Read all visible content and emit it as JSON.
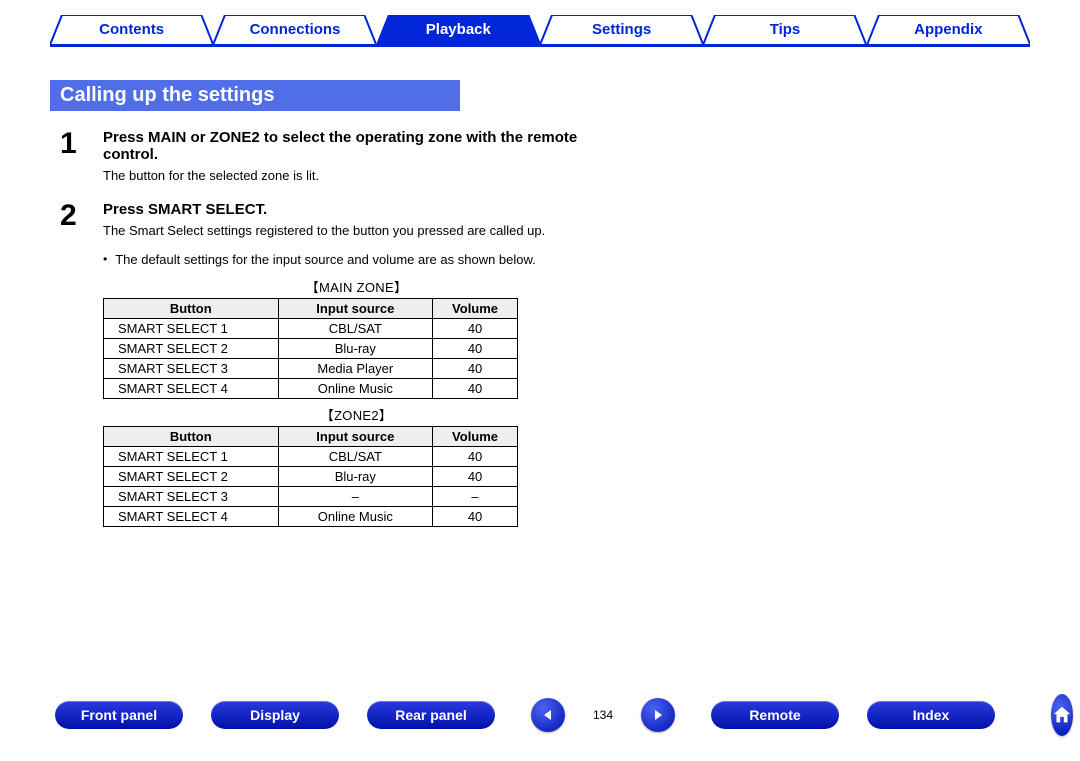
{
  "nav": {
    "tabs": [
      "Contents",
      "Connections",
      "Playback",
      "Settings",
      "Tips",
      "Appendix"
    ],
    "active_index": 2
  },
  "heading": "Calling up the settings",
  "steps": [
    {
      "num": "1",
      "title": "Press MAIN or ZONE2 to select the operating zone with the remote control.",
      "note": "The button for the selected zone is lit."
    },
    {
      "num": "2",
      "title": "Press SMART SELECT.",
      "note": "The Smart Select settings registered to the button you pressed are called up."
    }
  ],
  "bullet": "The default settings for the input source and volume are as shown below.",
  "tables": [
    {
      "caption": "【MAIN ZONE】",
      "headers": [
        "Button",
        "Input source",
        "Volume"
      ],
      "rows": [
        [
          "SMART SELECT 1",
          "CBL/SAT",
          "40"
        ],
        [
          "SMART SELECT 2",
          "Blu-ray",
          "40"
        ],
        [
          "SMART SELECT 3",
          "Media Player",
          "40"
        ],
        [
          "SMART SELECT 4",
          "Online Music",
          "40"
        ]
      ]
    },
    {
      "caption": "【ZONE2】",
      "headers": [
        "Button",
        "Input source",
        "Volume"
      ],
      "rows": [
        [
          "SMART SELECT 1",
          "CBL/SAT",
          "40"
        ],
        [
          "SMART SELECT 2",
          "Blu-ray",
          "40"
        ],
        [
          "SMART SELECT 3",
          "–",
          "–"
        ],
        [
          "SMART SELECT 4",
          "Online Music",
          "40"
        ]
      ]
    }
  ],
  "footer": {
    "buttons": [
      "Front panel",
      "Display",
      "Rear panel",
      "Remote",
      "Index"
    ],
    "page": "134"
  }
}
